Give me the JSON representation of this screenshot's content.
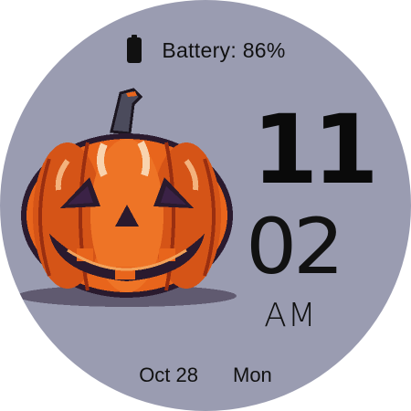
{
  "battery": {
    "label": "Battery: 86%",
    "icon": "battery-icon",
    "level": 0.86
  },
  "time": {
    "hour": "11",
    "minute": "02",
    "ampm": "AM"
  },
  "date": {
    "day": "Oct 28",
    "weekday": "Mon"
  },
  "illustration": {
    "name": "jack-o-lantern",
    "colors": {
      "background": "#9a9cb1",
      "pumpkin_orange": "#e8651c",
      "pumpkin_dark": "#b63d12",
      "outline": "#2a1a2e",
      "stem": "#4a4a5a",
      "highlight": "#f6c7a0"
    }
  }
}
